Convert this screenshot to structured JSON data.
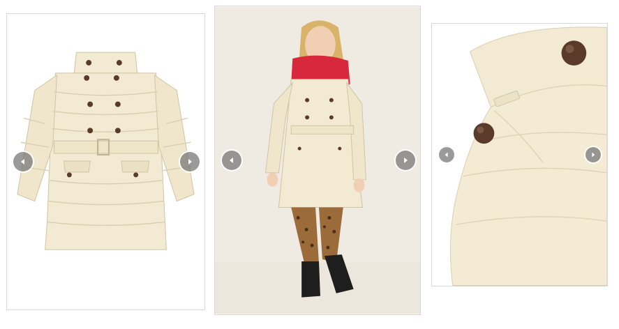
{
  "gallery": {
    "cards": [
      {
        "kind": "product-flat-lay",
        "bg": "#ffffff"
      },
      {
        "kind": "model-photo",
        "bg": "#efebe2"
      },
      {
        "kind": "detail-close-up",
        "bg": "#ffffff"
      }
    ]
  },
  "colors": {
    "coat": "#f2ead2",
    "coat_shadow": "#ddd3b6",
    "coat_line": "#cfc4a4",
    "button": "#5a3a2a",
    "scarf": "#d8283b",
    "leggings": "#9b6b3a",
    "leggings_spots": "#4a2e16",
    "boots": "#1e1e1e",
    "hair": "#d9b36a",
    "skin": "#f1cfb3",
    "nav_bg": "#7a7a7a",
    "nav_arrow": "#ffffff"
  },
  "icons": {
    "prev": "chevron-left-icon",
    "next": "chevron-right-icon"
  }
}
